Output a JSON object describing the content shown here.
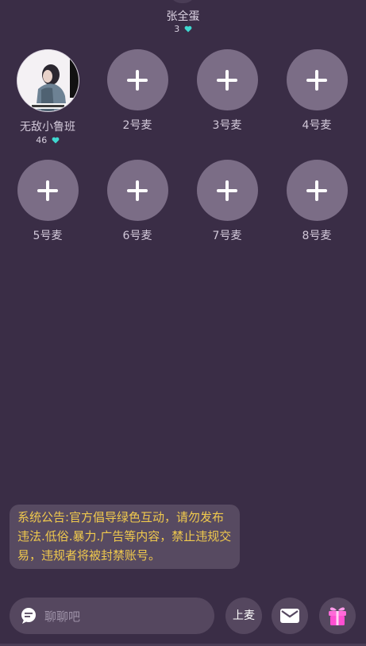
{
  "host": {
    "name": "张全蛋",
    "score": "3"
  },
  "seats": [
    {
      "label": "无敌小鲁班",
      "score": "46",
      "occupied": true
    },
    {
      "label": "2号麦",
      "occupied": false
    },
    {
      "label": "3号麦",
      "occupied": false
    },
    {
      "label": "4号麦",
      "occupied": false
    },
    {
      "label": "5号麦",
      "occupied": false
    },
    {
      "label": "6号麦",
      "occupied": false
    },
    {
      "label": "7号麦",
      "occupied": false
    },
    {
      "label": "8号麦",
      "occupied": false
    }
  ],
  "notice": {
    "text": "系统公告:官方倡导绿色互动，请勿发布违法.低俗.暴力.广告等内容，禁止违规交易，违规者将被封禁账号。"
  },
  "bottom": {
    "chat_placeholder": "聊聊吧",
    "mic_label": "上麦"
  },
  "colors": {
    "background": "#3a2d46",
    "seat_empty": "#7b6d86",
    "notice_text": "#f0c94d",
    "heart": "#3fd8d0",
    "gift": "#ff4fd1"
  },
  "icons": {
    "chat": "chat-bubble-icon",
    "message": "envelope-icon",
    "gift": "gift-box-icon",
    "heart": "heart-icon",
    "add_seat": "plus-icon"
  }
}
